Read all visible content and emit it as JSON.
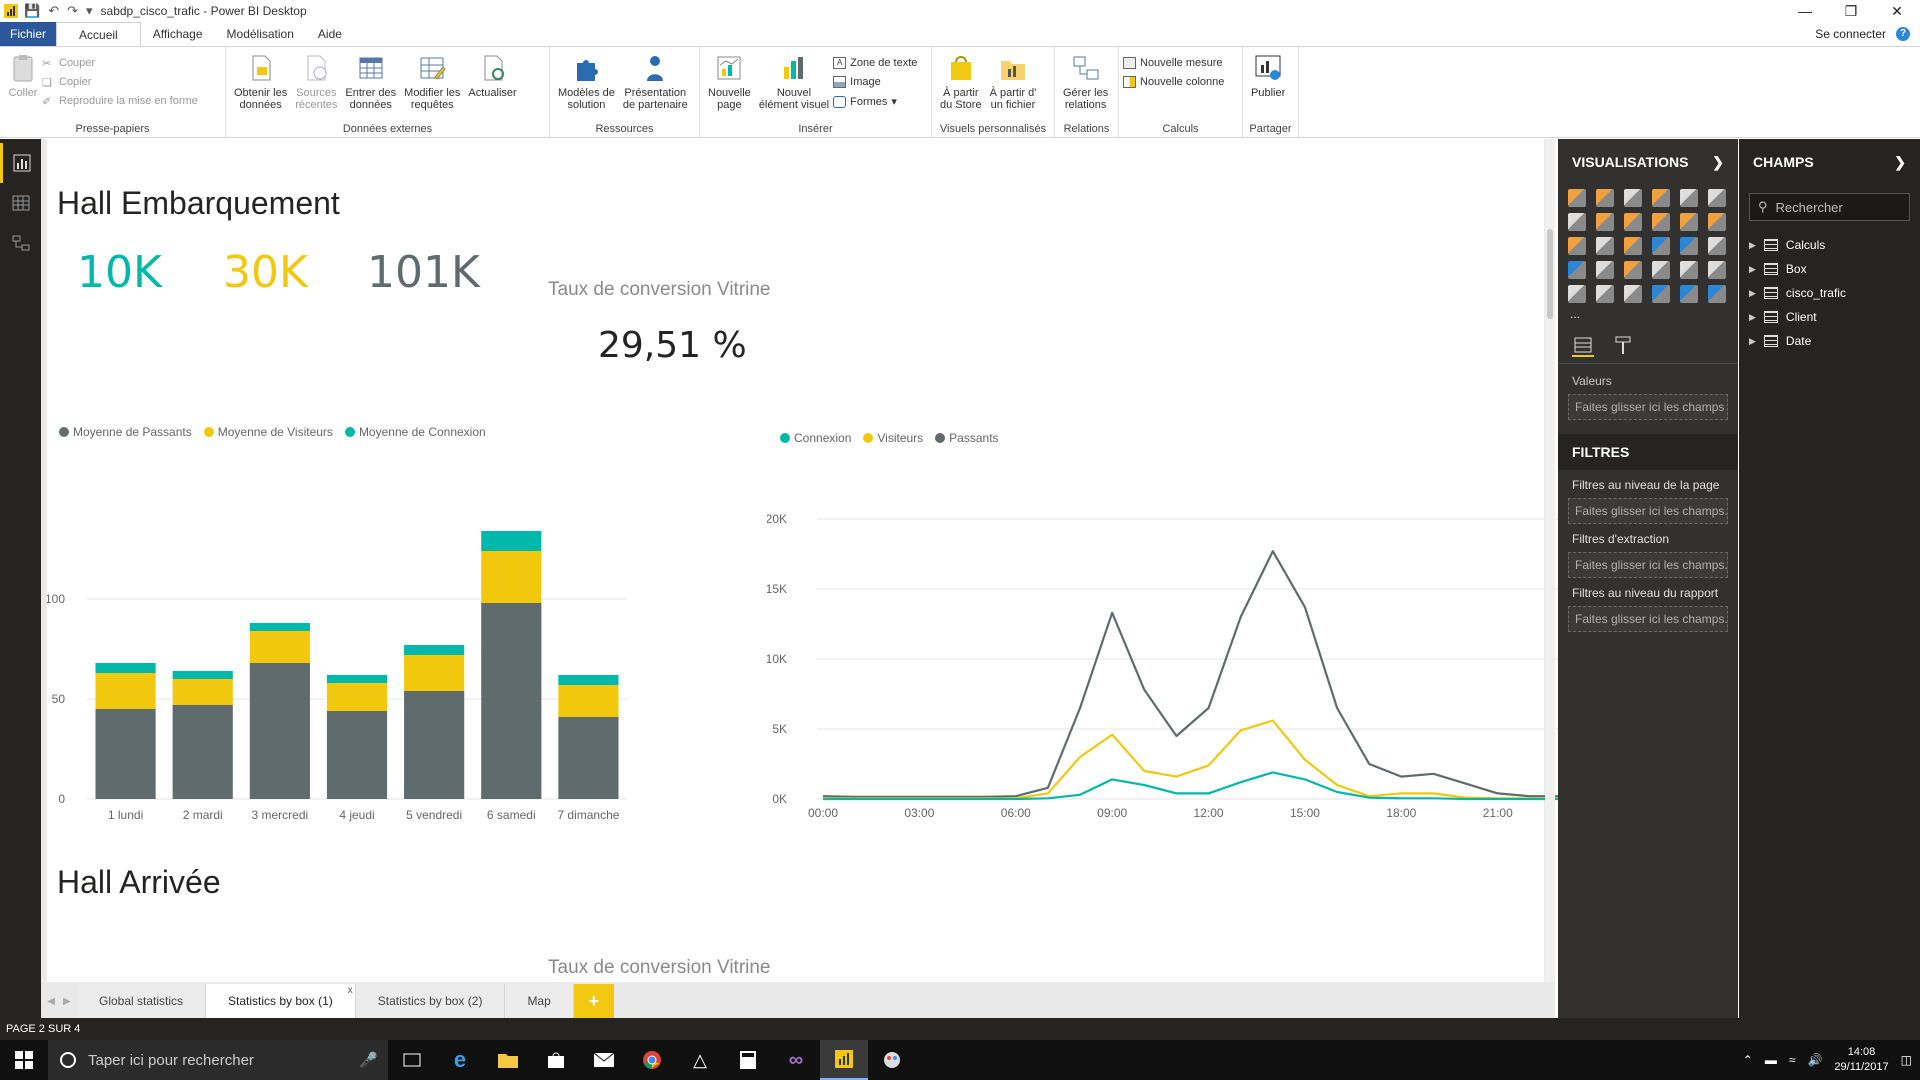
{
  "window": {
    "title": "sabdp_cisco_trafic - Power BI Desktop"
  },
  "tabs": {
    "file": "Fichier",
    "home": "Accueil",
    "view": "Affichage",
    "modeling": "Modélisation",
    "help": "Aide",
    "signin": "Se connecter",
    "help_badge": "?"
  },
  "ribbon": {
    "clipboard": {
      "paste": "Coller",
      "cut": "Couper",
      "copy": "Copier",
      "format_painter": "Reproduire la mise en forme",
      "group": "Presse-papiers"
    },
    "external": {
      "get_data_1": "Obtenir les",
      "get_data_2": "données",
      "recent_1": "Sources",
      "recent_2": "récentes",
      "enter_1": "Entrer des",
      "enter_2": "données",
      "edit_1": "Modifier les",
      "edit_2": "requêtes",
      "refresh": "Actualiser",
      "group": "Données externes"
    },
    "resources": {
      "templates_1": "Modèles de",
      "templates_2": "solution",
      "partner_1": "Présentation",
      "partner_2": "de partenaire",
      "group": "Ressources"
    },
    "insert": {
      "newpage_1": "Nouvelle",
      "newpage_2": "page",
      "newvisual_1": "Nouvel",
      "newvisual_2": "élément visuel",
      "textbox": "Zone de texte",
      "image": "Image",
      "shapes": "Formes",
      "group": "Insérer"
    },
    "custom": {
      "store_1": "À partir",
      "store_2": "du Store",
      "file_1": "À partir d'",
      "file_2": "un fichier",
      "group": "Visuels personnalisés"
    },
    "relations": {
      "manage_1": "Gérer les",
      "manage_2": "relations",
      "group": "Relations"
    },
    "calcs": {
      "measure": "Nouvelle mesure",
      "column": "Nouvelle colonne",
      "group": "Calculs"
    },
    "share": {
      "publish": "Publier",
      "group": "Partager"
    }
  },
  "report": {
    "section1_title": "Hall Embarquement",
    "kpi_connexion": "10K",
    "kpi_visiteurs": "30K",
    "kpi_passants": "101K",
    "conversion_title": "Taux de conversion Vitrine",
    "conversion_value": "29,51 %",
    "section2_title": "Hall Arrivée",
    "conversion_title_2": "Taux de conversion Vitrine"
  },
  "colors": {
    "connexion": "#01b8aa",
    "visiteurs": "#f2c80f",
    "passants": "#5f6b6d"
  },
  "chart_data": [
    {
      "type": "bar",
      "stacked": true,
      "categories": [
        "1 lundi",
        "2 mardi",
        "3 mercredi",
        "4 jeudi",
        "5 vendredi",
        "6 samedi",
        "7 dimanche"
      ],
      "series": [
        {
          "name": "Moyenne de Passants",
          "values": [
            45,
            47,
            68,
            44,
            54,
            98,
            41
          ]
        },
        {
          "name": "Moyenne de Visiteurs",
          "values": [
            18,
            13,
            16,
            14,
            18,
            26,
            16
          ]
        },
        {
          "name": "Moyenne de Connexion",
          "values": [
            5,
            4,
            4,
            4,
            5,
            10,
            5
          ]
        }
      ],
      "yticks": [
        0,
        50,
        100
      ],
      "ylim": [
        0,
        140
      ],
      "legend": "top-left",
      "grid": true
    },
    {
      "type": "line",
      "x": [
        "00:00",
        "01:00",
        "02:00",
        "03:00",
        "04:00",
        "05:00",
        "06:00",
        "07:00",
        "08:00",
        "09:00",
        "10:00",
        "11:00",
        "12:00",
        "13:00",
        "14:00",
        "15:00",
        "16:00",
        "17:00",
        "18:00",
        "19:00",
        "20:00",
        "21:00",
        "22:00",
        "23:00"
      ],
      "xticks": [
        "00:00",
        "03:00",
        "06:00",
        "09:00",
        "12:00",
        "15:00",
        "18:00",
        "21:00"
      ],
      "series": [
        {
          "name": "Connexion",
          "values": [
            0,
            0,
            0,
            0,
            0,
            0,
            0,
            50,
            300,
            1400,
            1000,
            400,
            400,
            1200,
            1900,
            1400,
            500,
            100,
            50,
            50,
            0,
            0,
            0,
            0
          ]
        },
        {
          "name": "Visiteurs",
          "values": [
            50,
            50,
            50,
            50,
            50,
            50,
            50,
            400,
            3000,
            4600,
            2000,
            1600,
            2400,
            4900,
            5600,
            2800,
            1000,
            200,
            400,
            400,
            100,
            50,
            50,
            50
          ]
        },
        {
          "name": "Passants",
          "values": [
            200,
            150,
            150,
            150,
            150,
            150,
            200,
            800,
            6500,
            13300,
            7800,
            4500,
            6500,
            13000,
            17700,
            13700,
            6500,
            2500,
            1600,
            1800,
            1100,
            400,
            200,
            200
          ]
        }
      ],
      "yticks": [
        "0K",
        "5K",
        "10K",
        "15K",
        "20K"
      ],
      "ylim": [
        0,
        20000
      ],
      "legend": "top-left",
      "grid": true
    }
  ],
  "pages": {
    "p1": "Global statistics",
    "p2": "Statistics by box (1)",
    "p3": "Statistics by box (2)",
    "p4": "Map",
    "add": "+",
    "close": "x"
  },
  "status": {
    "page": "PAGE 2 SUR 4"
  },
  "vis_pane": {
    "title": "VISUALISATIONS",
    "values_label": "Valeurs",
    "drop": "Faites glisser ici les champs ...",
    "filters": "FILTRES",
    "page_filters": "Filtres au niveau de la page",
    "drop2": "Faites glisser ici les champs...",
    "drill_filters": "Filtres d'extraction",
    "report_filters": "Filtres au niveau du rapport",
    "more": "..."
  },
  "fields_pane": {
    "title": "CHAMPS",
    "search_placeholder": "Rechercher",
    "tables": [
      "Calculs",
      "Box",
      "cisco_trafic",
      "Client",
      "Date"
    ]
  },
  "taskbar": {
    "search": "Taper ici pour rechercher",
    "time": "14:08",
    "date": "29/11/2017"
  }
}
